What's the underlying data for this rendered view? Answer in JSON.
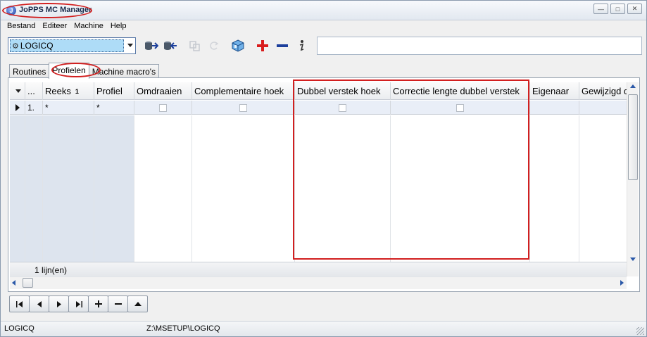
{
  "window": {
    "title": "JoPPS MC Manager",
    "buttons": [
      "minimize",
      "maximize",
      "close"
    ]
  },
  "menu": {
    "items": [
      "Bestand",
      "Editeer",
      "Machine",
      "Help"
    ]
  },
  "toolbar": {
    "machine_select": "LOGICQ",
    "search_value": "",
    "icons": [
      "import-icon",
      "export-icon",
      "copy-icon",
      "refresh-icon",
      "package-icon",
      "add-icon",
      "remove-icon",
      "info-icon"
    ]
  },
  "tabs": [
    {
      "label": "Routines",
      "active": false
    },
    {
      "label": "Profielen",
      "active": true
    },
    {
      "label": "Machine macro's",
      "active": false
    }
  ],
  "grid": {
    "columns": [
      {
        "label": "...",
        "sort": ""
      },
      {
        "label": "Reeks",
        "sort": "1"
      },
      {
        "label": "Profiel",
        "sort": ""
      },
      {
        "label": "Omdraaien",
        "sort": ""
      },
      {
        "label": "Complementaire hoek",
        "sort": ""
      },
      {
        "label": "Dubbel verstek hoek",
        "sort": ""
      },
      {
        "label": "Correctie lengte dubbel verstek",
        "sort": ""
      },
      {
        "label": "Eigenaar",
        "sort": ""
      },
      {
        "label": "Gewijzigd d",
        "sort": ""
      }
    ],
    "rows": [
      {
        "num": "1.",
        "reeks": "*",
        "profiel": "*",
        "omdraaien": false,
        "complementaire_hoek": false,
        "dubbel_verstek_hoek": false,
        "correctie_lengte": false,
        "eigenaar": "",
        "gewijzigd": ""
      }
    ],
    "footer": "1  lijn(en)"
  },
  "navigation": {
    "buttons": [
      "first",
      "previous",
      "next",
      "last",
      "add",
      "delete",
      "up"
    ]
  },
  "status": {
    "left": "LOGICQ",
    "path": "Z:\\MSETUP\\LOGICQ"
  },
  "colors": {
    "highlight": "#d21f1f",
    "selected_row": "#e9eef7",
    "combo_selection": "#aedcf7"
  }
}
